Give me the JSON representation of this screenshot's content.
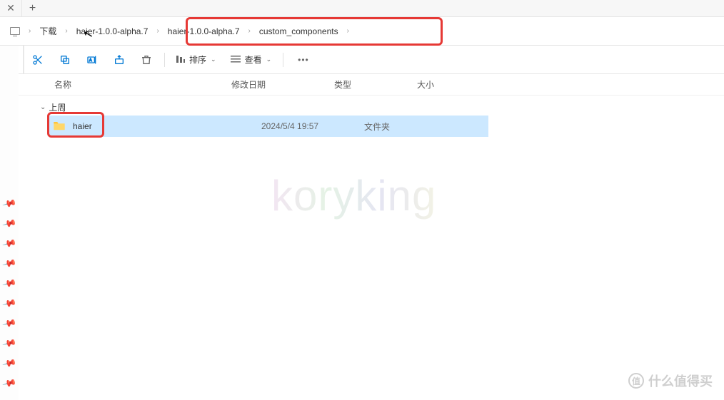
{
  "breadcrumb": {
    "items": [
      {
        "label": "下载"
      },
      {
        "label": "haier-1.0.0-alpha.7"
      },
      {
        "label": "haier-1.0.0-alpha.7"
      },
      {
        "label": "custom_components"
      }
    ]
  },
  "toolbar": {
    "sort_label": "排序",
    "view_label": "查看"
  },
  "columns": {
    "name": "名称",
    "date": "修改日期",
    "type": "类型",
    "size": "大小"
  },
  "group": {
    "label": "上周"
  },
  "files": [
    {
      "name": "haier",
      "date": "2024/5/4 19:57",
      "type": "文件夹",
      "size": ""
    }
  ],
  "watermark": "koryking",
  "bottom_watermark": {
    "badge": "值",
    "text": "什么值得买"
  }
}
